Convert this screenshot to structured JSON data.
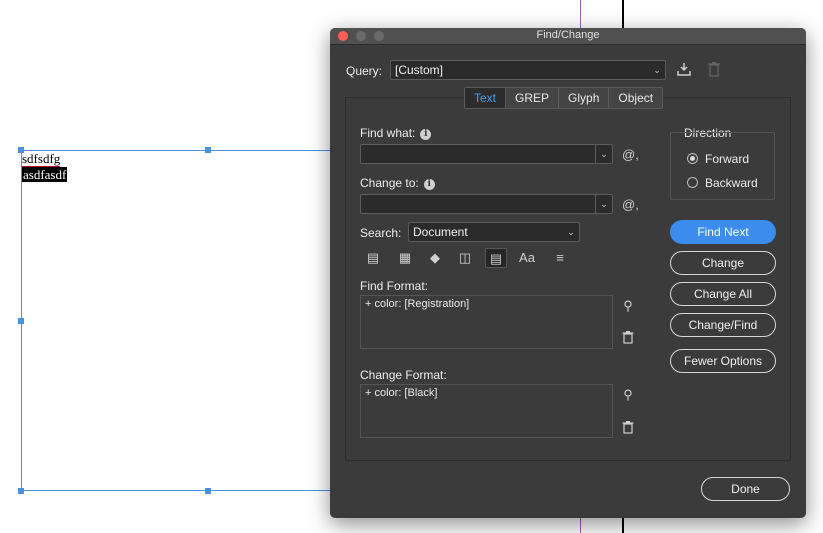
{
  "document": {
    "line1": "sdfsdfg",
    "line2": "asdfasdf"
  },
  "dialog": {
    "title": "Find/Change",
    "query_label": "Query:",
    "query_value": "[Custom]",
    "tabs": [
      {
        "label": "Text",
        "active": true
      },
      {
        "label": "GREP",
        "active": false
      },
      {
        "label": "Glyph",
        "active": false
      },
      {
        "label": "Object",
        "active": false
      }
    ],
    "find_what_label": "Find what:",
    "find_what_value": "",
    "change_to_label": "Change to:",
    "change_to_value": "",
    "search_label": "Search:",
    "search_value": "Document",
    "find_format_label": "Find Format:",
    "find_format_value": "+ color: [Registration]",
    "change_format_label": "Change Format:",
    "change_format_value": "+ color: [Black]",
    "direction": {
      "label": "Direction",
      "forward": "Forward",
      "backward": "Backward",
      "selected": "forward"
    },
    "buttons": {
      "find_next": "Find Next",
      "change": "Change",
      "change_all": "Change All",
      "change_find": "Change/Find",
      "fewer_options": "Fewer Options",
      "done": "Done"
    },
    "icons": {
      "special_chars": "@,",
      "case_sensitive": "Aa"
    },
    "colors": {
      "accent": "#3b8ced",
      "active_tab": "#4a9af5",
      "dialog_bg": "#3b3b3b",
      "close": "#ff5f57"
    }
  }
}
